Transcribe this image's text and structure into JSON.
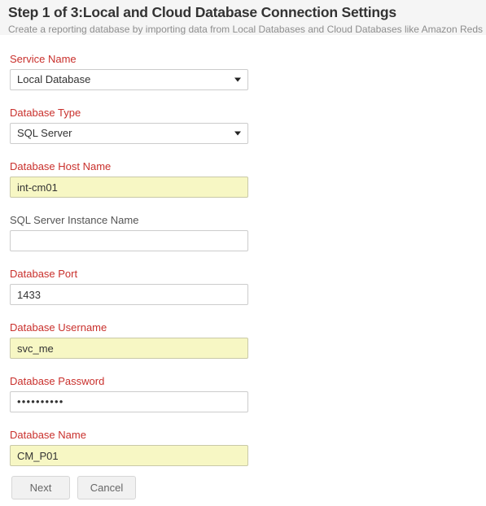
{
  "header": {
    "title": "Step 1 of 3:Local and Cloud Database Connection Settings",
    "subtitle": "Create a reporting database by importing data from Local Databases and Cloud Databases like Amazon Reds"
  },
  "form": {
    "fields": [
      {
        "label": "Service Name",
        "required": true,
        "type": "select",
        "value": "Local Database",
        "autofilled": false,
        "arrow_icon": "chevron-down-icon"
      },
      {
        "label": "Database Type",
        "required": true,
        "type": "select",
        "value": "SQL Server",
        "autofilled": false,
        "arrow_icon": "chevron-down-icon"
      },
      {
        "label": "Database Host Name",
        "required": true,
        "type": "text",
        "value": "int-cm01",
        "placeholder": "",
        "autofilled": true
      },
      {
        "label": "SQL Server Instance Name",
        "required": false,
        "type": "text",
        "value": "",
        "placeholder": "",
        "autofilled": false
      },
      {
        "label": "Database Port",
        "required": true,
        "type": "text",
        "value": "1433",
        "placeholder": "",
        "autofilled": false
      },
      {
        "label": "Database Username",
        "required": true,
        "type": "text",
        "value": "svc_me",
        "placeholder": "",
        "autofilled": true
      },
      {
        "label": "Database Password",
        "required": true,
        "type": "password",
        "value": "••••••••••",
        "placeholder": "",
        "autofilled": false
      },
      {
        "label": "Database Name",
        "required": true,
        "type": "text",
        "value": "CM_P01",
        "placeholder": "",
        "autofilled": true
      }
    ]
  },
  "buttons": {
    "next_label": "Next",
    "cancel_label": "Cancel"
  },
  "colors": {
    "required_label": "#c9302c",
    "optional_label": "#555555",
    "autofill_background": "#f7f7c4",
    "header_band": "#f5f5f5",
    "title_text": "#333333",
    "subtitle_text": "#8d8d8d",
    "button_face": "#f1f1f1"
  }
}
